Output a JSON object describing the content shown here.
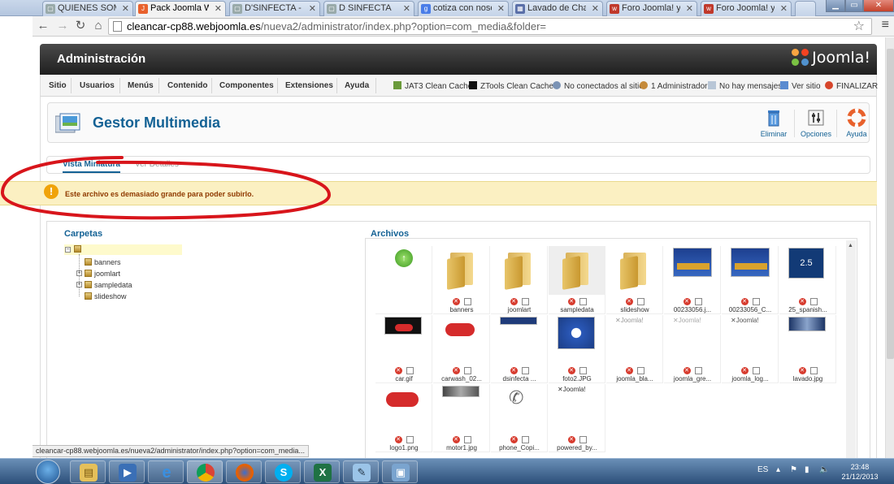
{
  "browser": {
    "tabs": [
      {
        "label": "QUIENES SOMOS",
        "active": false
      },
      {
        "label": "Pack Joomla Web",
        "active": true
      },
      {
        "label": "D'SINFECTA - Mat",
        "active": false
      },
      {
        "label": "D SINFECTA",
        "active": false
      },
      {
        "label": "cotiza con nosotro",
        "active": false
      },
      {
        "label": "Lavado de Chasis",
        "active": false
      },
      {
        "label": "Foro Joomla! y We",
        "active": false
      },
      {
        "label": "Foro Joomla! y We",
        "active": false
      }
    ],
    "url_domain": "cleancar-cp88.webjoomla.es",
    "url_path": "/nueva2/administrator/index.php?option=com_media&folder=",
    "status_url": "cleancar-cp88.webjoomla.es/nueva2/administrator/index.php?option=com_media..."
  },
  "header": {
    "title": "Administración",
    "logo_text": "Joomla!"
  },
  "menu": {
    "items": [
      "Sitio",
      "Usuarios",
      "Menús",
      "Contenido",
      "Componentes",
      "Extensiones",
      "Ayuda"
    ],
    "status": {
      "jat3": "JAT3 Clean Cache",
      "ztools": "ZTools Clean Cache",
      "offline": "No conectados al sitio",
      "admins": "1 Administrador",
      "messages": "No hay mensajes",
      "view_site": "Ver sitio",
      "logout": "FINALIZAR"
    }
  },
  "toolbar": {
    "title": "Gestor Multimedia",
    "delete_label": "Eliminar",
    "options_label": "Opciones",
    "help_label": "Ayuda"
  },
  "view_tabs": {
    "thumbnail": "Vista Miniatura",
    "details": "Ver Detalles"
  },
  "alert": {
    "message": "Este archivo es demasiado grande para poder subirlo."
  },
  "folders": {
    "title": "Carpetas",
    "items": [
      "banners",
      "joomlart",
      "sampledata",
      "slideshow"
    ]
  },
  "files": {
    "title": "Archivos",
    "items": [
      {
        "name": "",
        "kind": "up"
      },
      {
        "name": "banners",
        "kind": "folder"
      },
      {
        "name": "joomlart",
        "kind": "folder"
      },
      {
        "name": "sampledata",
        "kind": "folder"
      },
      {
        "name": "slideshow",
        "kind": "folder"
      },
      {
        "name": "00233056.j...",
        "kind": "image"
      },
      {
        "name": "00233056_C...",
        "kind": "image"
      },
      {
        "name": "25_spanish...",
        "kind": "image"
      },
      {
        "name": "car.gif",
        "kind": "image"
      },
      {
        "name": "carwash_02...",
        "kind": "image"
      },
      {
        "name": "dsinfecta ...",
        "kind": "image"
      },
      {
        "name": "foto2.JPG",
        "kind": "image"
      },
      {
        "name": "joomla_bla...",
        "kind": "image"
      },
      {
        "name": "joomla_gre...",
        "kind": "image"
      },
      {
        "name": "joomla_log...",
        "kind": "image"
      },
      {
        "name": "lavado.jpg",
        "kind": "image"
      },
      {
        "name": "logo1.png",
        "kind": "image"
      },
      {
        "name": "motor1.jpg",
        "kind": "image"
      },
      {
        "name": "phone_Copi...",
        "kind": "image"
      },
      {
        "name": "powered_by...",
        "kind": "image"
      }
    ]
  },
  "taskbar": {
    "lang": "ES",
    "time": "23:48",
    "date": "21/12/2013"
  }
}
